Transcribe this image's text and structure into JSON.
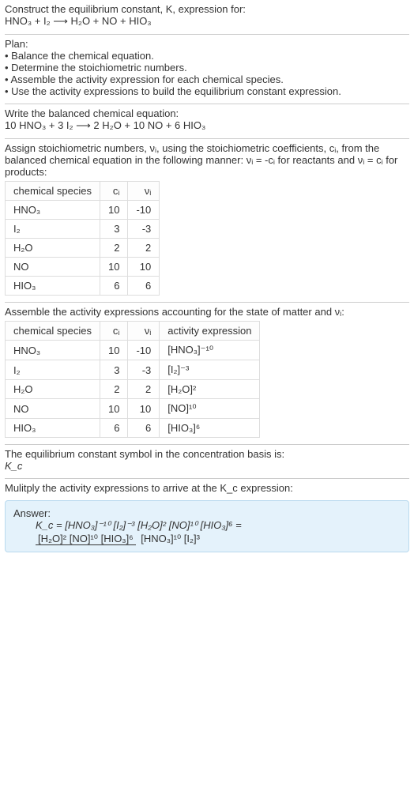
{
  "header": {
    "line1": "Construct the equilibrium constant, K, expression for:",
    "equation": "HNO₃ + I₂ ⟶ H₂O + NO + HIO₃"
  },
  "plan": {
    "title": "Plan:",
    "items": [
      "Balance the chemical equation.",
      "Determine the stoichiometric numbers.",
      "Assemble the activity expression for each chemical species.",
      "Use the activity expressions to build the equilibrium constant expression."
    ]
  },
  "balanced": {
    "intro": "Write the balanced chemical equation:",
    "equation": "10 HNO₃ + 3 I₂ ⟶ 2 H₂O + 10 NO + 6 HIO₃"
  },
  "stoich_intro": "Assign stoichiometric numbers, νᵢ, using the stoichiometric coefficients, cᵢ, from the balanced chemical equation in the following manner: νᵢ = -cᵢ for reactants and νᵢ = cᵢ for products:",
  "stoich_table": {
    "headers": [
      "chemical species",
      "cᵢ",
      "νᵢ"
    ],
    "rows": [
      {
        "sp": "HNO₃",
        "c": "10",
        "v": "-10"
      },
      {
        "sp": "I₂",
        "c": "3",
        "v": "-3"
      },
      {
        "sp": "H₂O",
        "c": "2",
        "v": "2"
      },
      {
        "sp": "NO",
        "c": "10",
        "v": "10"
      },
      {
        "sp": "HIO₃",
        "c": "6",
        "v": "6"
      }
    ]
  },
  "activity_intro": "Assemble the activity expressions accounting for the state of matter and νᵢ:",
  "activity_table": {
    "headers": [
      "chemical species",
      "cᵢ",
      "νᵢ",
      "activity expression"
    ],
    "rows": [
      {
        "sp": "HNO₃",
        "c": "10",
        "v": "-10",
        "expr": "[HNO₃]⁻¹⁰"
      },
      {
        "sp": "I₂",
        "c": "3",
        "v": "-3",
        "expr": "[I₂]⁻³"
      },
      {
        "sp": "H₂O",
        "c": "2",
        "v": "2",
        "expr": "[H₂O]²"
      },
      {
        "sp": "NO",
        "c": "10",
        "v": "10",
        "expr": "[NO]¹⁰"
      },
      {
        "sp": "HIO₃",
        "c": "6",
        "v": "6",
        "expr": "[HIO₃]⁶"
      }
    ]
  },
  "kc_symbol": {
    "line1": "The equilibrium constant symbol in the concentration basis is:",
    "line2": "K_c"
  },
  "multiply": "Mulitply the activity expressions to arrive at the K_c expression:",
  "answer": {
    "label": "Answer:",
    "lhs": "K_c = [HNO₃]⁻¹⁰ [I₂]⁻³ [H₂O]² [NO]¹⁰ [HIO₃]⁶ = ",
    "num": "[H₂O]² [NO]¹⁰ [HIO₃]⁶",
    "den": "[HNO₃]¹⁰ [I₂]³"
  },
  "chart_data": {
    "type": "table",
    "title": "Stoichiometric numbers and activity expressions",
    "tables": [
      {
        "headers": [
          "chemical species",
          "c_i",
          "nu_i"
        ],
        "rows": [
          [
            "HNO3",
            10,
            -10
          ],
          [
            "I2",
            3,
            -3
          ],
          [
            "H2O",
            2,
            2
          ],
          [
            "NO",
            10,
            10
          ],
          [
            "HIO3",
            6,
            6
          ]
        ]
      },
      {
        "headers": [
          "chemical species",
          "c_i",
          "nu_i",
          "activity expression"
        ],
        "rows": [
          [
            "HNO3",
            10,
            -10,
            "[HNO3]^-10"
          ],
          [
            "I2",
            3,
            -3,
            "[I2]^-3"
          ],
          [
            "H2O",
            2,
            2,
            "[H2O]^2"
          ],
          [
            "NO",
            10,
            10,
            "[NO]^10"
          ],
          [
            "HIO3",
            6,
            6,
            "[HIO3]^6"
          ]
        ]
      }
    ]
  }
}
